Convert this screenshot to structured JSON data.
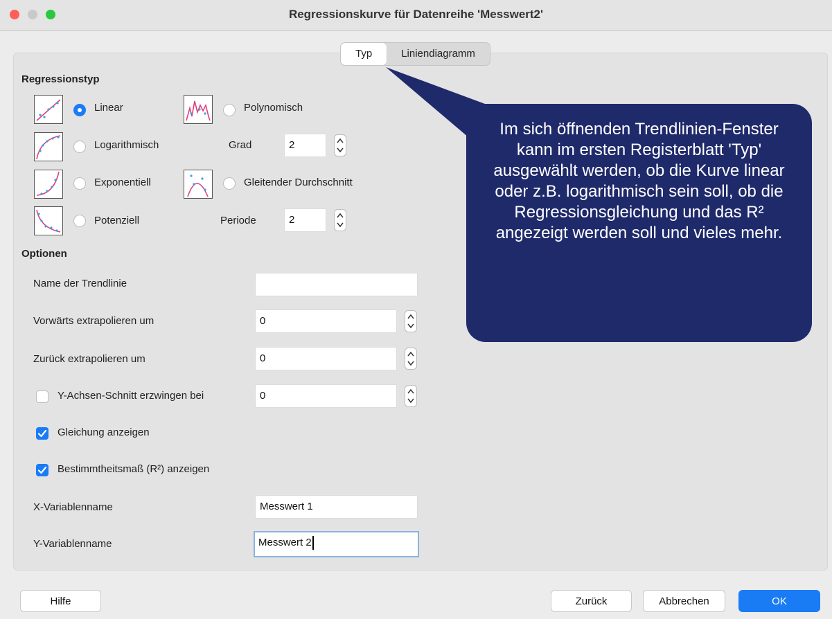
{
  "window": {
    "title": "Regressionskurve für Datenreihe 'Messwert2'",
    "traffic_lights": {
      "close": "#fe5f57",
      "minimize": "#c9c9c9",
      "zoom": "#28c840"
    }
  },
  "tabs": [
    {
      "label": "Typ",
      "active": true
    },
    {
      "label": "Liniendiagramm",
      "active": false
    }
  ],
  "regression": {
    "heading": "Regressionstyp",
    "options": {
      "linear": {
        "label": "Linear",
        "selected": true
      },
      "polynomisch": {
        "label": "Polynomisch",
        "selected": false
      },
      "logarithmisch": {
        "label": "Logarithmisch",
        "selected": false
      },
      "exponentiell": {
        "label": "Exponentiell",
        "selected": false
      },
      "gleitender": {
        "label": "Gleitender Durchschnitt",
        "selected": false
      },
      "potenziell": {
        "label": "Potenziell",
        "selected": false
      }
    },
    "grad": {
      "label": "Grad",
      "value": "2"
    },
    "periode": {
      "label": "Periode",
      "value": "2"
    }
  },
  "optionen": {
    "heading": "Optionen",
    "name": {
      "label": "Name der Trendlinie",
      "value": ""
    },
    "vorwaerts": {
      "label": "Vorwärts extrapolieren um",
      "value": "0"
    },
    "zurueck": {
      "label": "Zurück extrapolieren um",
      "value": "0"
    },
    "y_achsen": {
      "label": "Y-Achsen-Schnitt erzwingen bei",
      "value": "0",
      "checked": false
    },
    "gleichung": {
      "label": "Gleichung anzeigen",
      "checked": true
    },
    "bestimmtheit": {
      "label": "Bestimmtheitsmaß (R²) anzeigen",
      "checked": true
    },
    "x_var": {
      "label": "X-Variablenname",
      "value": "Messwert 1"
    },
    "y_var": {
      "label": "Y-Variablenname",
      "value": "Messwert 2"
    }
  },
  "callout": {
    "text": "Im sich öffnenden Trendlinien-Fenster kann im ersten Registerblatt 'Typ' ausgewählt werden, ob die Kurve linear oder z.B. logarithmisch sein soll, ob die Regressionsgleichung und das R² angezeigt werden soll und vieles mehr."
  },
  "buttons": {
    "help": "Hilfe",
    "back": "Zurück",
    "cancel": "Abbrechen",
    "ok": "OK"
  },
  "colors": {
    "accent": "#1a7cf5",
    "callout": "#1f2a6b",
    "thumb_line": "#e0407a",
    "thumb_dots": "#3aa0e8"
  }
}
